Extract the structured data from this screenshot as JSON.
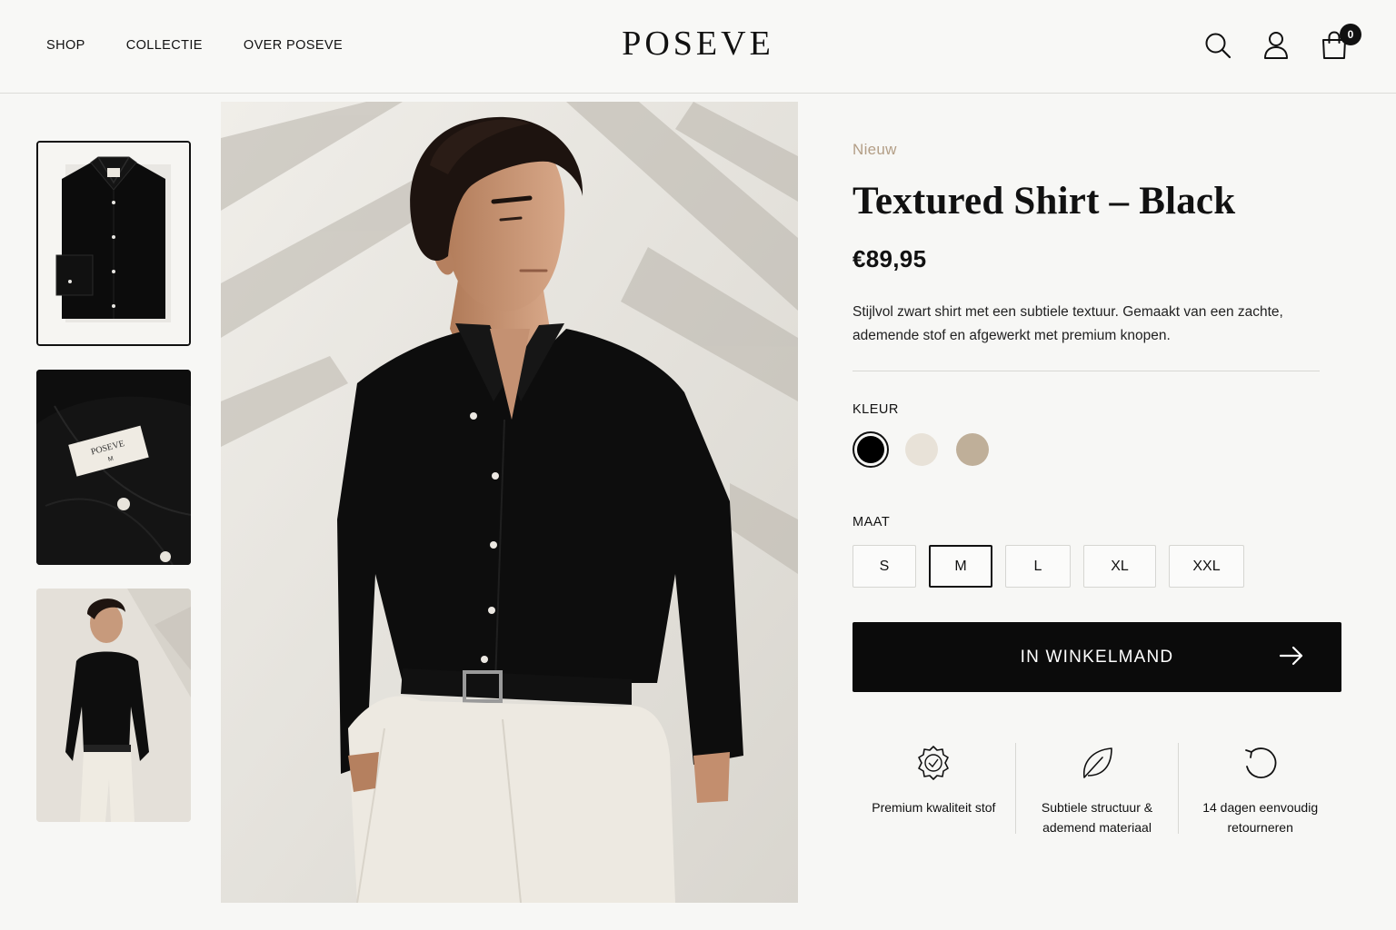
{
  "header": {
    "nav": [
      "SHOP",
      "COLLECTIE",
      "OVER POSEVE"
    ],
    "logo": "POSEVE",
    "icons": [
      "search-icon",
      "user-icon",
      "shopping-bag-icon"
    ],
    "cart_count": "0"
  },
  "thumbnails": [
    {
      "name": "thumbnail-folded-shirt",
      "selected": true
    },
    {
      "name": "thumbnail-collar-detail",
      "label_text": "POSEVE",
      "label_size": "M"
    },
    {
      "name": "thumbnail-model"
    }
  ],
  "product": {
    "badge": "Nieuw",
    "title": "Textured Shirt – Black",
    "price": "€89,95",
    "description": "Stijlvol zwart shirt met een subtiele textuur. Gemaakt van een zachte, ademende stof en afgewerkt met premium knopen.",
    "color_label": "KLEUR",
    "colors": [
      {
        "name": "black",
        "hex": "#000000",
        "selected": true
      },
      {
        "name": "cream",
        "hex": "#e8e2d8",
        "selected": false
      },
      {
        "name": "sand",
        "hex": "#bfaf99",
        "selected": false
      }
    ],
    "size_label": "MAAT",
    "sizes": [
      "S",
      "M",
      "L",
      "XL",
      "XXL"
    ],
    "selected_size": "M",
    "cta": "IN WINKELMAND",
    "features": [
      {
        "icon": "quality-seal-icon",
        "text": "Premium kwaliteit stof"
      },
      {
        "icon": "leaf-icon",
        "text": "Subtiele structuur & ademend materiaal"
      },
      {
        "icon": "return-arrow-icon",
        "text": "14 dagen eenvoudig retourneren"
      }
    ]
  },
  "colors": {
    "accent": "#b39e86",
    "primary": "#0b0b0b",
    "background": "#f7f7f5"
  }
}
